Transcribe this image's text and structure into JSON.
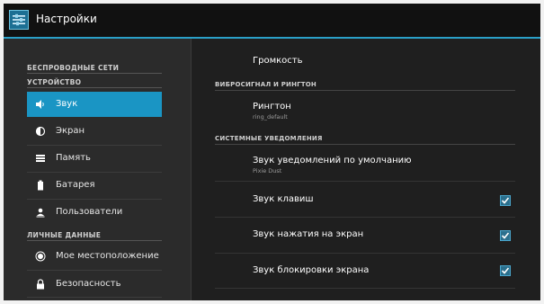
{
  "app": {
    "title": "Настройки"
  },
  "sidebar": {
    "headers": {
      "wireless": "БЕСПРОВОДНЫЕ СЕТИ",
      "device": "УСТРОЙСТВО",
      "personal": "ЛИЧНЫЕ ДАННЫЕ"
    },
    "items": [
      {
        "label": "Звук",
        "icon": "volume-icon",
        "selected": true
      },
      {
        "label": "Экран",
        "icon": "brightness-icon"
      },
      {
        "label": "Память",
        "icon": "storage-icon"
      },
      {
        "label": "Батарея",
        "icon": "battery-icon"
      },
      {
        "label": "Пользователи",
        "icon": "users-icon"
      },
      {
        "label": "Мое местоположение",
        "icon": "location-icon"
      },
      {
        "label": "Безопасность",
        "icon": "lock-icon"
      }
    ]
  },
  "main": {
    "volume": {
      "title": "Громкость"
    },
    "vibration_header": "ВИБРОСИГНАЛ И РИНГТОН",
    "ringtone": {
      "title": "Рингтон",
      "summary": "ring_default"
    },
    "system_header": "СИСТЕМНЫЕ УВЕДОМЛЕНИЯ",
    "default_notification": {
      "title": "Звук уведомлений по умолчанию",
      "summary": "Pixie Dust"
    },
    "key_sounds": {
      "title": "Звук клавиш",
      "checked": true
    },
    "touch_sounds": {
      "title": "Звук нажатия на экран",
      "checked": true
    },
    "lock_sounds": {
      "title": "Звук блокировки экрана",
      "checked": true
    }
  },
  "colors": {
    "accent": "#1a95c4",
    "background": "#1f1f1f"
  }
}
